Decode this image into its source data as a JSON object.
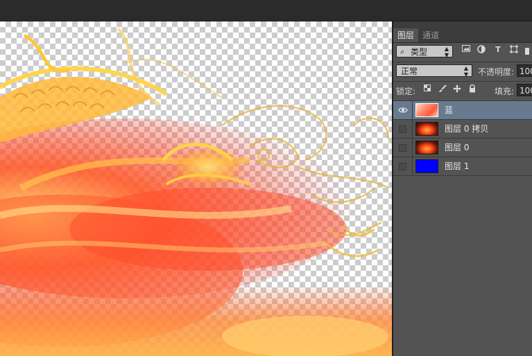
{
  "panel": {
    "tabs": [
      {
        "label": "图层",
        "active": true
      },
      {
        "label": "通道",
        "active": false
      }
    ],
    "filter": {
      "selected": "类型",
      "icon": "search-icon"
    },
    "filter_icons": [
      "image-filter-icon",
      "adjustment-filter-icon",
      "text-filter-icon",
      "shape-filter-icon"
    ],
    "blend_mode": "正常",
    "opacity_label": "不透明度:",
    "opacity_value": "100",
    "lock_label": "锁定:",
    "lock_icons": [
      "lock-transparent-icon",
      "lock-brush-icon",
      "lock-move-icon",
      "lock-all-icon"
    ],
    "fill_label": "填充:",
    "fill_value": "100",
    "layers": [
      {
        "name": "蓝",
        "visible": true,
        "selected": true,
        "thumbnail": "fire-dragon-light"
      },
      {
        "name": "图层 0 拷贝",
        "visible": false,
        "selected": false,
        "thumbnail": "fire-dragon-dark"
      },
      {
        "name": "图层 0",
        "visible": false,
        "selected": false,
        "thumbnail": "fire-dragon-dark"
      },
      {
        "name": "图层 1",
        "visible": false,
        "selected": false,
        "thumbnail": "solid-blue",
        "color": "#0000ff"
      }
    ]
  }
}
